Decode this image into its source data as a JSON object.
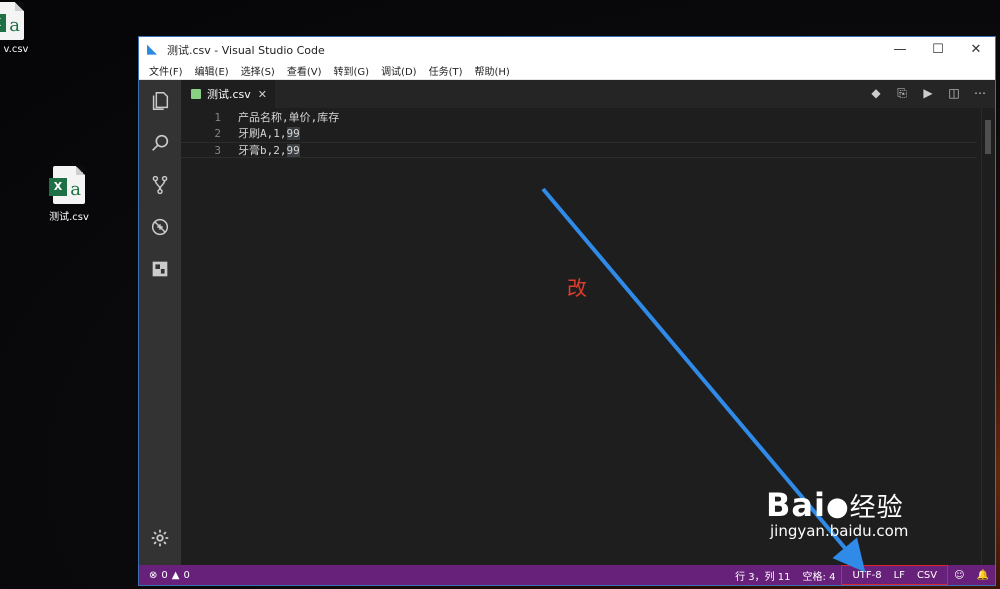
{
  "desktop": {
    "icon_top_label": "v.csv",
    "icon_main_label": "测试.csv"
  },
  "window": {
    "title": "测试.csv - Visual Studio Code",
    "controls": {
      "minimize": "—",
      "maximize": "☐",
      "close": "✕"
    }
  },
  "menu": [
    "文件(F)",
    "编辑(E)",
    "选择(S)",
    "查看(V)",
    "转到(G)",
    "调试(D)",
    "任务(T)",
    "帮助(H)"
  ],
  "activity_bar": [
    "explorer-icon",
    "search-icon",
    "source-control-icon",
    "debug-icon",
    "extensions-icon",
    "gear-icon"
  ],
  "tab": {
    "label": "测试.csv",
    "close": "✕"
  },
  "tab_actions": [
    "compare-icon",
    "open-preview-icon",
    "run-icon",
    "split-editor-icon",
    "more-icon"
  ],
  "editor": {
    "lines": [
      {
        "num": "1",
        "pre": "产品名称,单价,库存",
        "hl": ""
      },
      {
        "num": "2",
        "pre": "牙刷A,1,",
        "hl": "99"
      },
      {
        "num": "3",
        "pre": "牙膏b,2,",
        "hl": "99"
      }
    ]
  },
  "annotation": "改",
  "status": {
    "errors": "0",
    "warnings": "0",
    "position": "行 3，列 11",
    "spaces": "空格: 4",
    "encoding": "UTF-8",
    "eol": "LF",
    "language": "CSV"
  },
  "watermark": {
    "main": "Bai",
    "brand_suffix": "经验",
    "url": "jingyan.baidu.com"
  },
  "colors": {
    "statusbar": "#68217a",
    "annotation": "#e03b2f",
    "arrow": "#2f8ae8"
  }
}
